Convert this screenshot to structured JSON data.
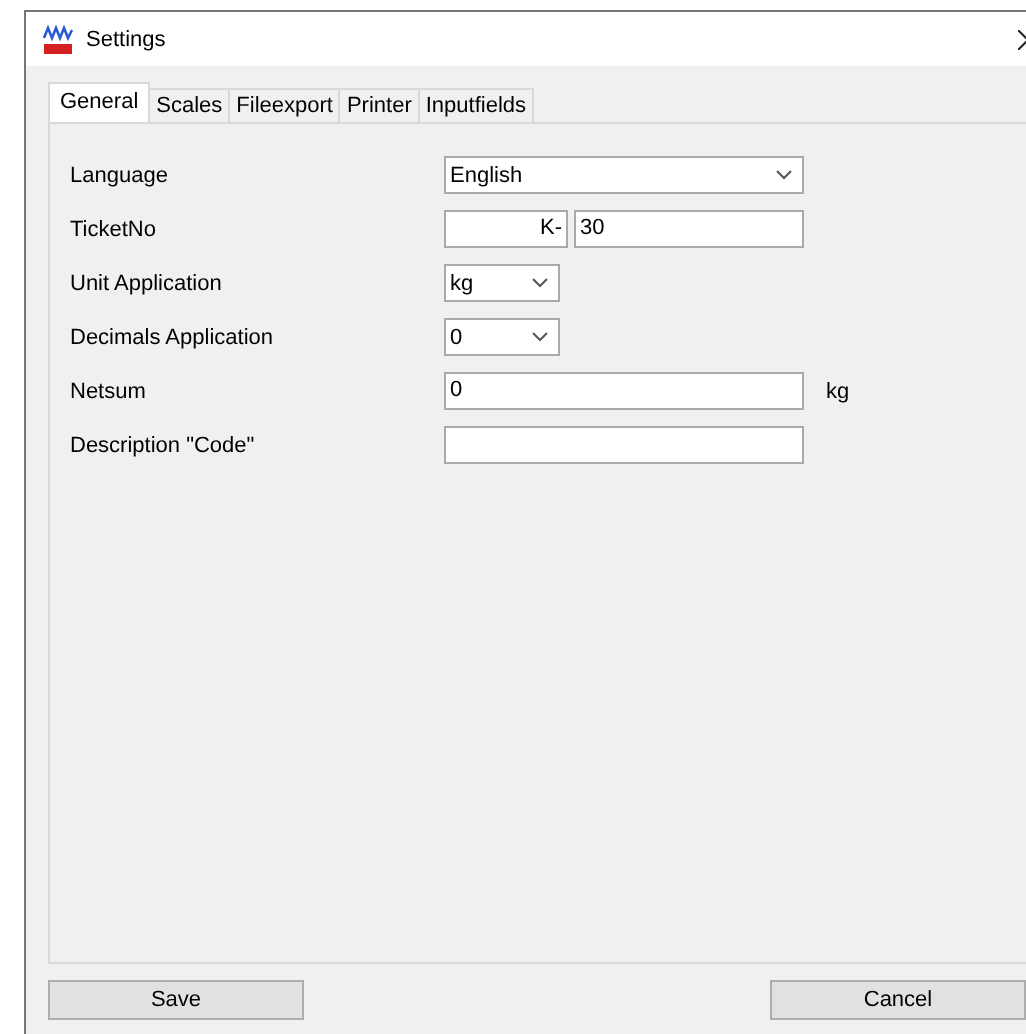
{
  "window": {
    "title": "Settings"
  },
  "tabs": [
    {
      "label": "General",
      "selected": true
    },
    {
      "label": "Scales",
      "selected": false
    },
    {
      "label": "Fileexport",
      "selected": false
    },
    {
      "label": "Printer",
      "selected": false
    },
    {
      "label": "Inputfields",
      "selected": false
    }
  ],
  "fields": [
    {
      "label": "Language",
      "kind": "dropdown",
      "value": "English"
    },
    {
      "label": "TicketNo",
      "kind": "prefixed",
      "prefix": "K-",
      "value": "30"
    },
    {
      "label": "Unit Application",
      "kind": "short-dropdown",
      "value": "kg"
    },
    {
      "label": "Decimals Application",
      "kind": "short-dropdown",
      "value": "0"
    },
    {
      "label": "Netsum",
      "kind": "text",
      "value": "0",
      "unit": "kg"
    },
    {
      "label": "Description \"Code\"",
      "kind": "text"
    }
  ],
  "buttons": [
    "Save",
    "Cancel"
  ]
}
